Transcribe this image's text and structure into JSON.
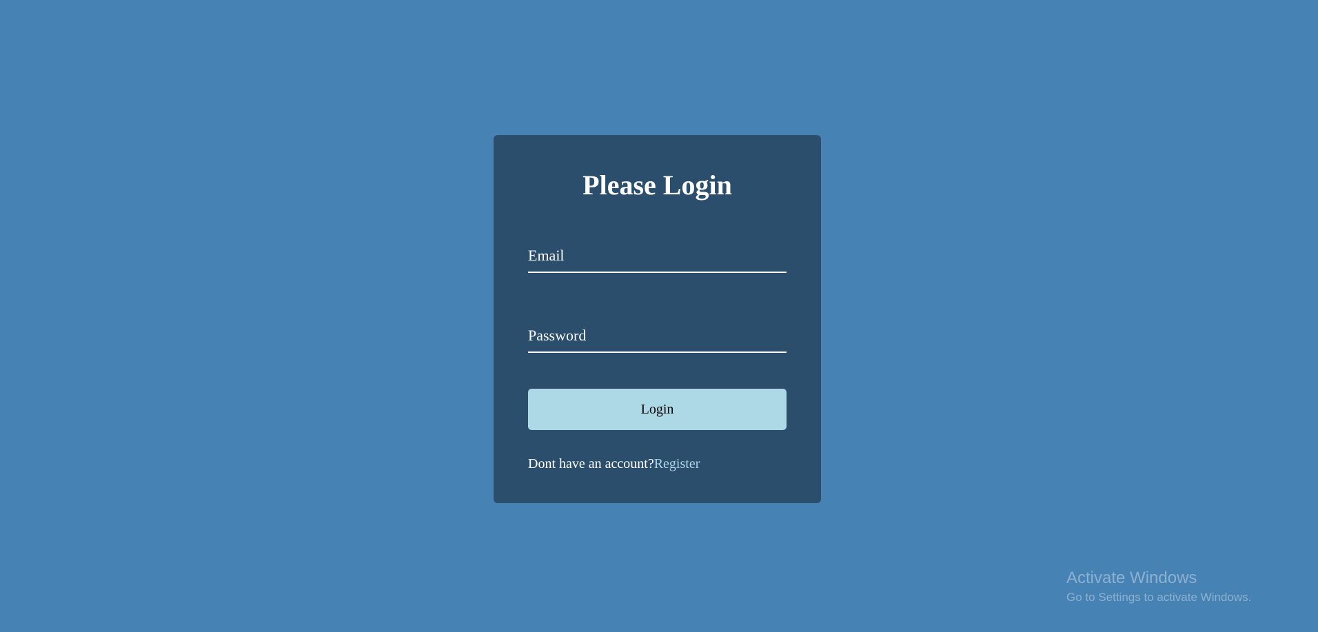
{
  "login": {
    "title": "Please Login",
    "email": {
      "placeholder": "Email",
      "value": ""
    },
    "password": {
      "placeholder": "Password",
      "value": ""
    },
    "button_label": "Login",
    "register_prompt": "Dont have an account?",
    "register_link": "Register"
  },
  "watermark": {
    "title": "Activate Windows",
    "subtitle": "Go to Settings to activate Windows."
  },
  "colors": {
    "page_background": "#4682b4",
    "card_background": "#2a4e6c",
    "button_background": "#add8e6",
    "link": "#add8e6",
    "text": "#ffffff"
  }
}
